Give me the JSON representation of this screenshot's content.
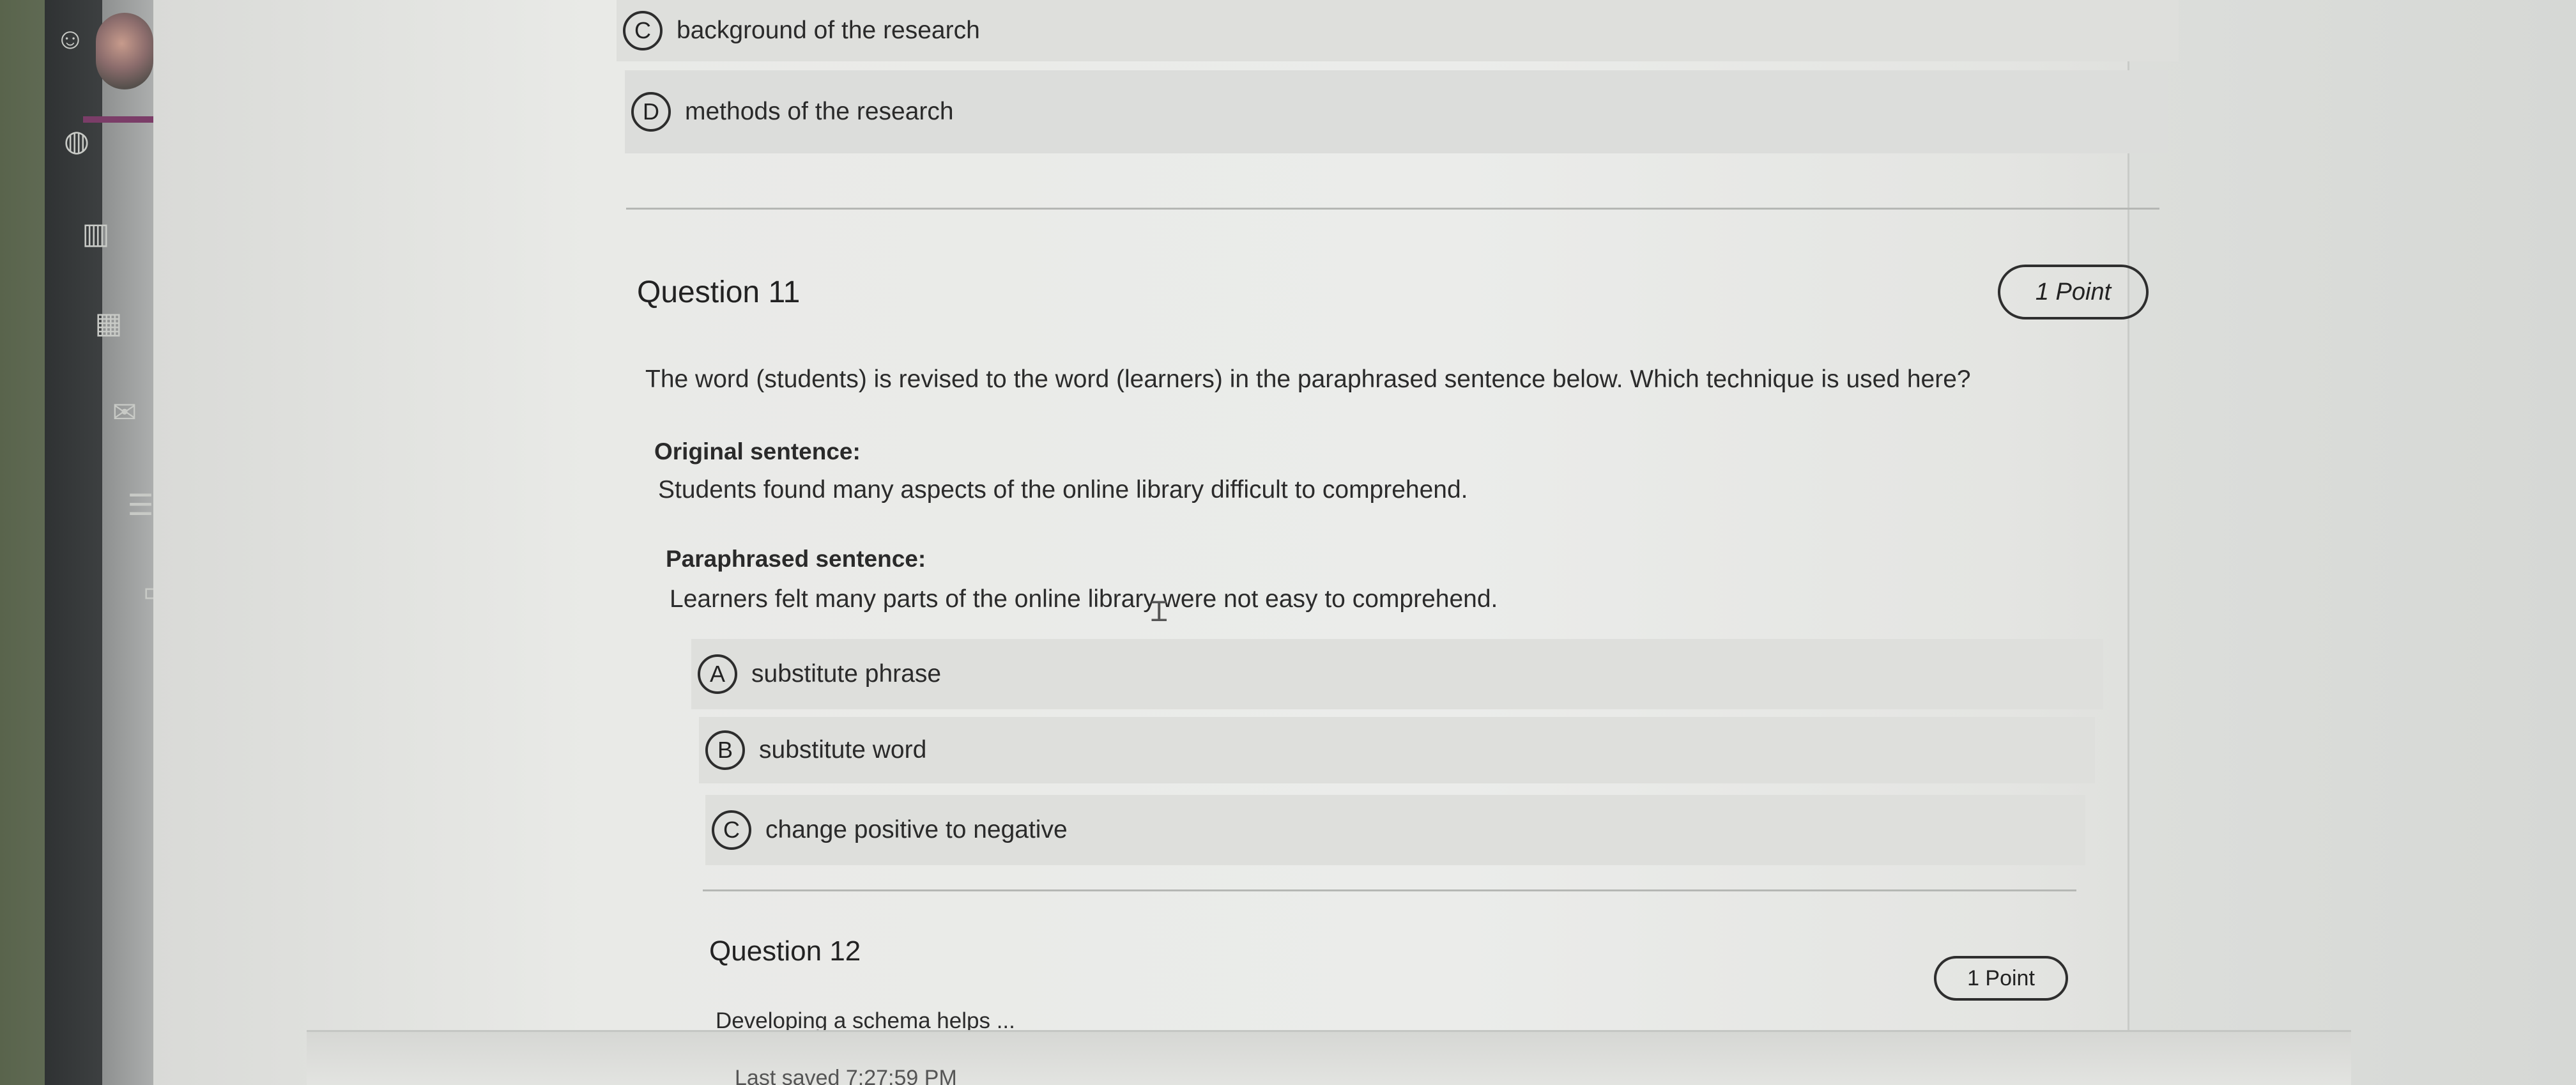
{
  "previous_question": {
    "options": [
      {
        "letter": "C",
        "text": "background of the research"
      },
      {
        "letter": "D",
        "text": "methods of the research"
      }
    ]
  },
  "question_11": {
    "title": "Question 11",
    "points": "1 Point",
    "prompt": "The word (students) is revised to the word (learners) in the paraphrased sentence below. Which technique is used here?",
    "original_label": "Original sentence:",
    "original_text": "Students found many aspects of the online library difficult to comprehend.",
    "paraphrased_label": "Paraphrased sentence:",
    "paraphrased_text": "Learners felt many parts of the online library were not easy to comprehend.",
    "options": [
      {
        "letter": "A",
        "text": "substitute phrase"
      },
      {
        "letter": "B",
        "text": "substitute word"
      },
      {
        "letter": "C",
        "text": "change positive to negative"
      }
    ]
  },
  "question_12": {
    "title": "Question 12",
    "points": "1 Point",
    "prompt": "Developing a schema helps ..."
  },
  "footer": {
    "status": "Last saved 7:27:59 PM"
  },
  "icons": {
    "sidebar": [
      "avatar",
      "globe-icon",
      "book-icon",
      "calendar-icon",
      "mail-icon",
      "notes-icon",
      "chat-icon",
      "history-icon"
    ]
  },
  "colors": {
    "accent": "#7b3d68"
  }
}
